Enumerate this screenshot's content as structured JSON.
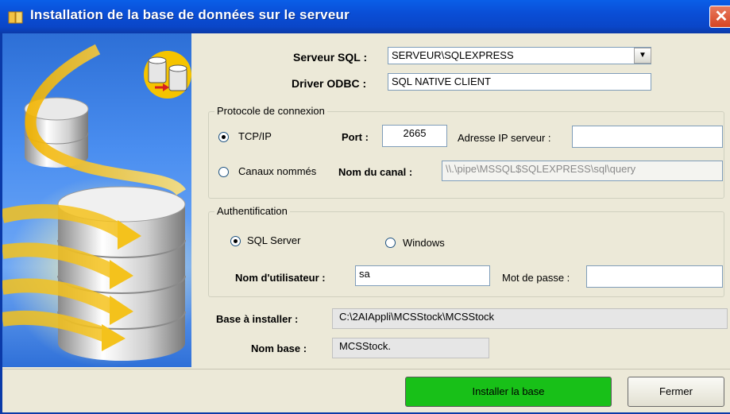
{
  "window": {
    "title": "Installation de la base de données sur le serveur"
  },
  "server": {
    "sql_label": "Serveur SQL :",
    "sql_value": "SERVEUR\\SQLEXPRESS",
    "odbc_label": "Driver ODBC :",
    "odbc_value": "SQL NATIVE CLIENT"
  },
  "protocol": {
    "legend": "Protocole de connexion",
    "tcp_label": "TCP/IP",
    "port_label": "Port :",
    "port_value": "2665",
    "ip_label": "Adresse IP serveur :",
    "ip_value": "",
    "pipes_label": "Canaux nommés",
    "pipe_name_label": "Nom du canal :",
    "pipe_name_value": "\\\\.\\pipe\\MSSQL$SQLEXPRESS\\sql\\query",
    "selected": "TCP/IP"
  },
  "auth": {
    "legend": "Authentification",
    "sql_label": "SQL Server",
    "windows_label": "Windows",
    "user_label": "Nom d'utilisateur :",
    "user_value": "sa",
    "password_label": "Mot de passe :",
    "password_value": "",
    "selected": "SQL Server"
  },
  "install": {
    "base_label": "Base à installer :",
    "base_value": "C:\\2AIAppli\\MCSStock\\MCSStock",
    "name_label": "Nom base :",
    "name_value": "MCSStock."
  },
  "buttons": {
    "install": "Installer la base",
    "close": "Fermer"
  },
  "colors": {
    "titlebar": "#0a4ed6",
    "install_button": "#18c018",
    "close_button": "#d64522"
  }
}
